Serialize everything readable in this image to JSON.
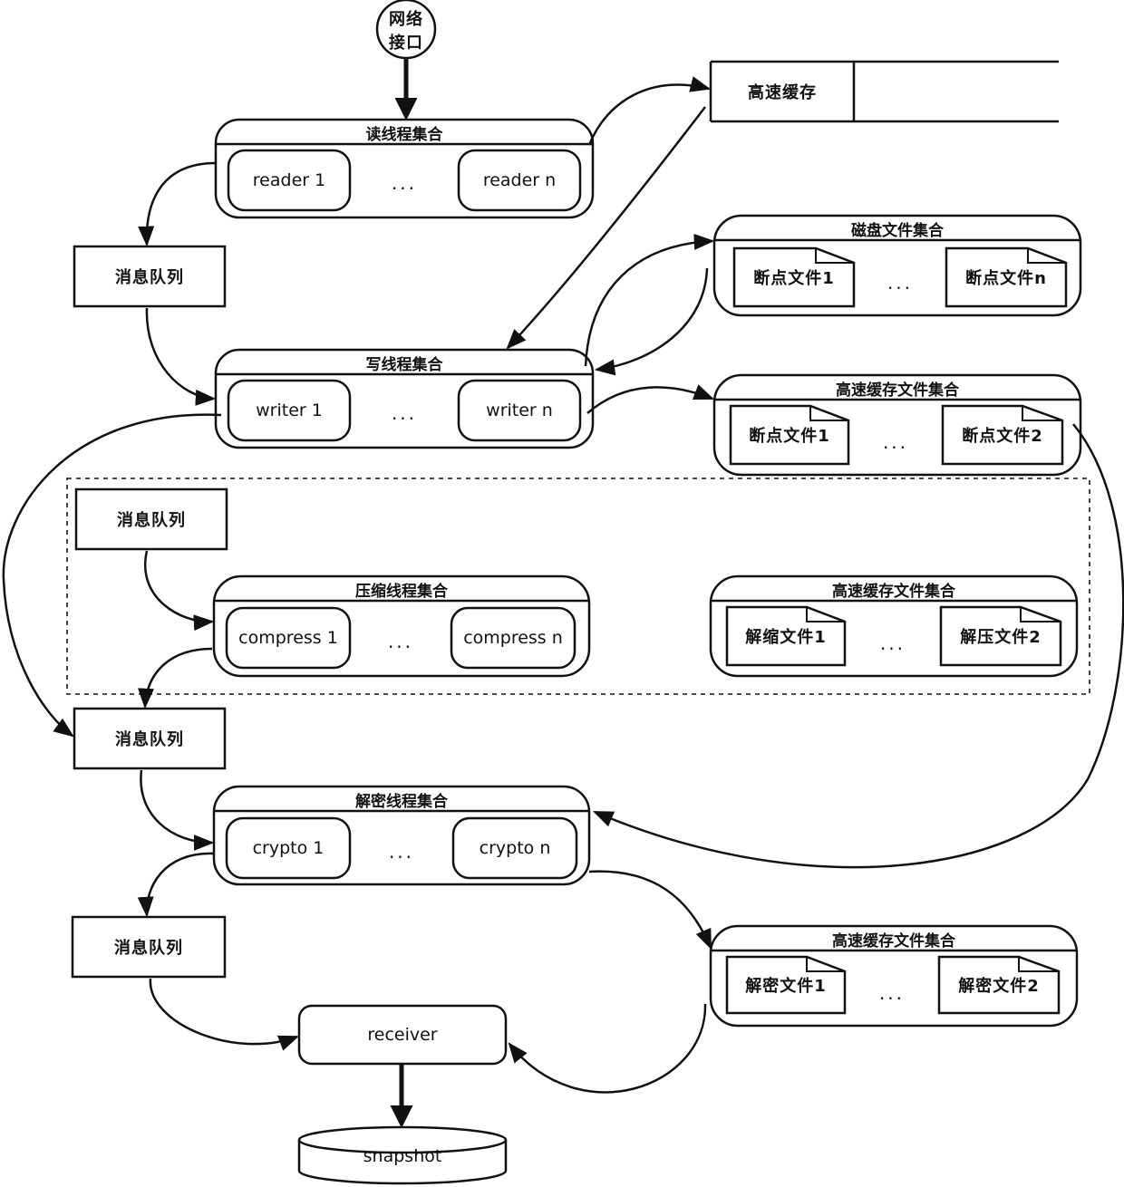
{
  "network_interface": {
    "label_line1": "网络",
    "label_line2": "接口"
  },
  "cache": {
    "label": "高速缓存"
  },
  "reader_group": {
    "title": "读线程集合",
    "items": [
      "reader 1",
      "reader n"
    ],
    "ellipsis": "..."
  },
  "writer_group": {
    "title": "写线程集合",
    "items": [
      "writer 1",
      "writer n"
    ],
    "ellipsis": "..."
  },
  "compress_group": {
    "title": "压缩线程集合",
    "items": [
      "compress 1",
      "compress n"
    ],
    "ellipsis": "..."
  },
  "crypto_group": {
    "title": "解密线程集合",
    "items": [
      "crypto 1",
      "crypto n"
    ],
    "ellipsis": "..."
  },
  "disk_files": {
    "title": "磁盘文件集合",
    "files": [
      "断点文件1",
      "断点文件n"
    ],
    "ellipsis": "..."
  },
  "cache_files_1": {
    "title": "高速缓存文件集合",
    "files": [
      "断点文件1",
      "断点文件2"
    ],
    "ellipsis": "..."
  },
  "cache_files_2": {
    "title": "高速缓存文件集合",
    "files": [
      "解缩文件1",
      "解压文件2"
    ],
    "ellipsis": "..."
  },
  "cache_files_3": {
    "title": "高速缓存文件集合",
    "files": [
      "解密文件1",
      "解密文件2"
    ],
    "ellipsis": "..."
  },
  "queues": [
    "消息队列",
    "消息队列",
    "消息队列",
    "消息队列"
  ],
  "receiver": {
    "label": "receiver"
  },
  "snapshot": {
    "label": "snapshot"
  }
}
